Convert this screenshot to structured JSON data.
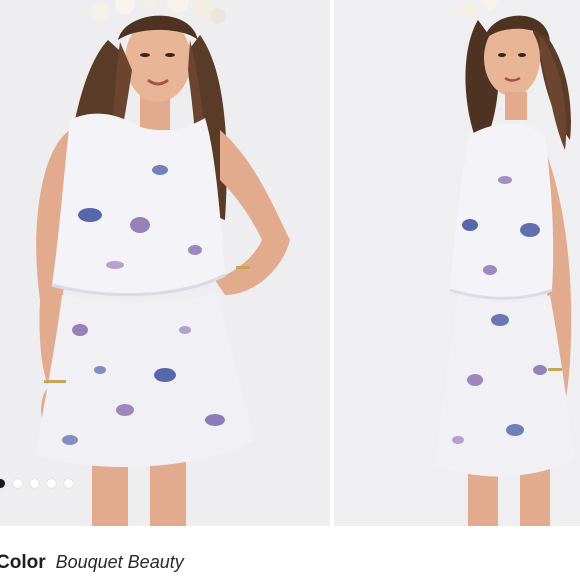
{
  "carousel": {
    "slide_count": 5,
    "active_index": 0
  },
  "product_attribute": {
    "label": "Color",
    "value": "Bouquet Beauty"
  },
  "colors": {
    "background": "#ffffff",
    "photo_backdrop": "#eeeef0",
    "dress_base": "#f4f3f7",
    "floral_blue": "#3b4f9c",
    "floral_purple": "#7a5aa6",
    "dot_active": "#1a1a1a",
    "dot_inactive": "#ffffff"
  }
}
